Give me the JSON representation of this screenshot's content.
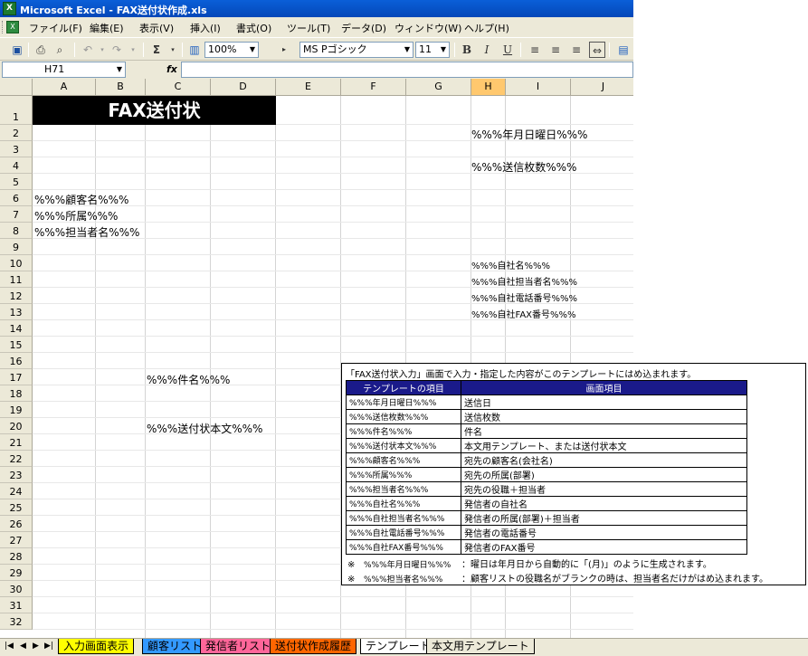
{
  "window": {
    "title": "Microsoft Excel - FAX送付状作成.xls",
    "app_icon": "excel-icon"
  },
  "menu": [
    "ファイル(F)",
    "編集(E)",
    "表示(V)",
    "挿入(I)",
    "書式(O)",
    "ツール(T)",
    "データ(D)",
    "ウィンドウ(W)",
    "ヘルプ(H)"
  ],
  "toolbar": {
    "zoom": "100%",
    "font_name": "MS Pゴシック",
    "font_size": "11",
    "bold": "B",
    "italic": "I",
    "underline": "U",
    "sum": "Σ"
  },
  "formula_bar": {
    "name_box": "H71",
    "fx": "fx",
    "content": ""
  },
  "columns": [
    "A",
    "B",
    "C",
    "D",
    "E",
    "F",
    "G",
    "H",
    "I",
    "J"
  ],
  "selected_column": "H",
  "rows": [
    "1",
    "2",
    "3",
    "4",
    "5",
    "6",
    "7",
    "8",
    "9",
    "10",
    "11",
    "12",
    "13",
    "14",
    "15",
    "16",
    "17",
    "18",
    "19",
    "20",
    "21",
    "22",
    "23",
    "24",
    "25",
    "26",
    "27",
    "28",
    "29",
    "30",
    "31",
    "32"
  ],
  "cells": {
    "title": "FAX送付状",
    "date": "%%%年月日曜日%%%",
    "pages": "%%%送信枚数%%%",
    "customer": "%%%顧客名%%%",
    "dept": "%%%所属%%%",
    "person": "%%%担当者名%%%",
    "own_company": "%%%自社名%%%",
    "own_person": "%%%自社担当者名%%%",
    "own_tel": "%%%自社電話番号%%%",
    "own_fax": "%%%自社FAX番号%%%",
    "subject": "%%%件名%%%",
    "body": "%%%送付状本文%%%"
  },
  "infobox": {
    "intro": "「FAX送付状入力」画面で入力・指定した内容がこのテンプレートにはめ込まれます。",
    "headers": [
      "テンプレートの項目",
      "画面項目"
    ],
    "rows": [
      [
        "%%%年月日曜日%%%",
        "送信日"
      ],
      [
        "%%%送信枚数%%%",
        "送信枚数"
      ],
      [
        "%%%件名%%%",
        "件名"
      ],
      [
        "%%%送付状本文%%%",
        "本文用テンプレート、または送付状本文"
      ],
      [
        "%%%顧客名%%%",
        "宛先の顧客名(会社名)"
      ],
      [
        "%%%所属%%%",
        "宛先の所属(部署)"
      ],
      [
        "%%%担当者名%%%",
        "宛先の役職＋担当者"
      ],
      [
        "%%%自社名%%%",
        "発信者の自社名"
      ],
      [
        "%%%自社担当者名%%%",
        "発信者の所属(部署)＋担当者"
      ],
      [
        "%%%自社電話番号%%%",
        "発信者の電話番号"
      ],
      [
        "%%%自社FAX番号%%%",
        "発信者のFAX番号"
      ]
    ],
    "notes": [
      {
        "mark": "※",
        "key": "%%%年月日曜日%%%",
        "text": "：曜日は年月日から自動的に「(月)」のように生成されます。"
      },
      {
        "mark": "※",
        "key": "%%%担当者名%%%",
        "text": "：顧客リストの役職名がブランクの時は、担当者名だけがはめ込まれます。"
      }
    ]
  },
  "sheet_tabs": [
    {
      "label": "入力画面表示",
      "color": "#ffff00"
    },
    {
      "label": "顧客リスト",
      "color": "#3399ff"
    },
    {
      "label": "発信者リスト",
      "color": "#ff6699"
    },
    {
      "label": "送付状作成履歴",
      "color": "#ff6600"
    },
    {
      "label": "テンプレート",
      "color": "#ffffff",
      "active": true
    },
    {
      "label": "本文用テンプレート",
      "color": "#ece9d8"
    }
  ]
}
